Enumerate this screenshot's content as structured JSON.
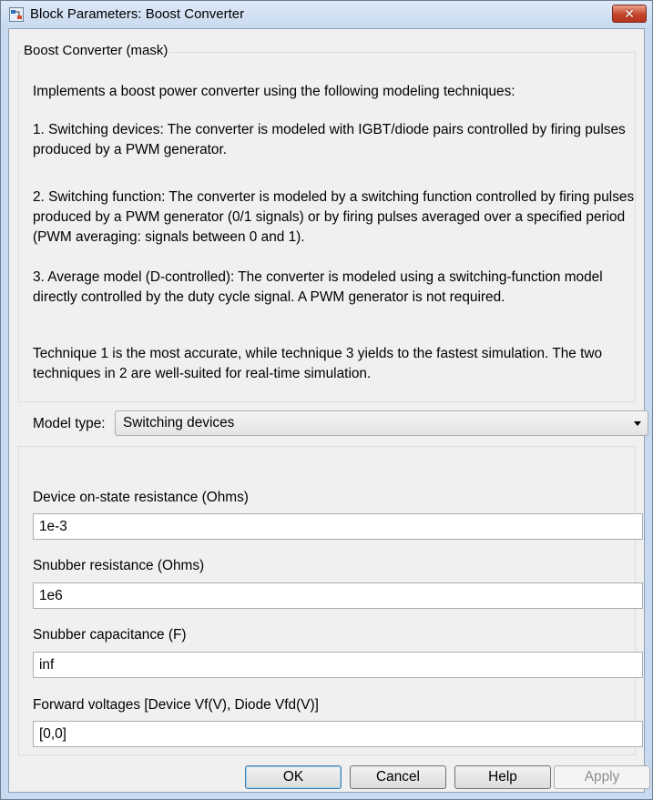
{
  "window": {
    "title": "Block Parameters: Boost Converter",
    "close_glyph": "✕"
  },
  "group": {
    "legend": "Boost Converter (mask)",
    "description": [
      "Implements a boost power converter using the following modeling techniques:",
      "1. Switching devices: The converter is modeled with IGBT/diode pairs controlled by firing pulses produced by a PWM generator.",
      "2. Switching function: The converter is modeled by a switching function controlled by firing pulses produced by a PWM generator (0/1 signals) or by firing pulses averaged over a specified period (PWM averaging: signals between 0 and 1).",
      "3. Average model (D-controlled): The converter is modeled using a switching-function model directly controlled by the duty cycle signal. A PWM generator is not required.",
      "Technique 1 is the most accurate, while technique 3 yields to the fastest simulation. The two techniques in 2 are well-suited for real-time simulation."
    ]
  },
  "model_type": {
    "label": "Model type:",
    "value": "Switching devices"
  },
  "params": [
    {
      "label": "Device on-state resistance (Ohms)",
      "value": "1e-3"
    },
    {
      "label": "Snubber resistance (Ohms)",
      "value": "1e6"
    },
    {
      "label": "Snubber capacitance (F)",
      "value": "inf"
    },
    {
      "label": "Forward voltages [Device Vf(V), Diode Vfd(V)]",
      "value": "[0,0]"
    }
  ],
  "buttons": {
    "ok": "OK",
    "cancel": "Cancel",
    "help": "Help",
    "apply": "Apply"
  },
  "colors": {
    "title_bar": "#c9daf0",
    "close_button": "#c7452a",
    "client_bg": "#f0f0f0"
  }
}
